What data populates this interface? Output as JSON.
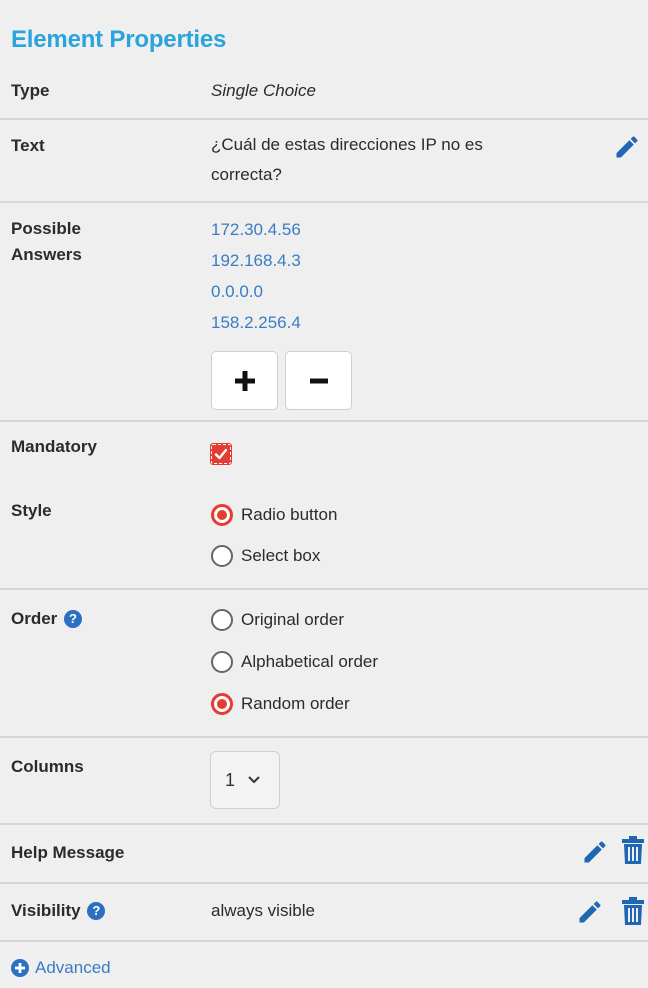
{
  "panel": {
    "title": "Element Properties"
  },
  "type": {
    "label": "Type",
    "value": "Single Choice"
  },
  "text": {
    "label": "Text",
    "line1": "¿Cuál de estas direcciones IP no es",
    "line2": "correcta?"
  },
  "answers": {
    "label_line1": "Possible",
    "label_line2": "Answers",
    "items": [
      "172.30.4.56",
      "192.168.4.3",
      "0.0.0.0",
      "158.2.256.4"
    ],
    "add_label": "+",
    "remove_label": "−"
  },
  "mandatory": {
    "label": "Mandatory",
    "checked": true
  },
  "style": {
    "label": "Style",
    "options": [
      {
        "label": "Radio button",
        "selected": true
      },
      {
        "label": "Select box",
        "selected": false
      }
    ]
  },
  "order": {
    "label": "Order",
    "options": [
      {
        "label": "Original order",
        "selected": false
      },
      {
        "label": "Alphabetical order",
        "selected": false
      },
      {
        "label": "Random order",
        "selected": true
      }
    ]
  },
  "columns": {
    "label": "Columns",
    "value": "1"
  },
  "help_message": {
    "label": "Help Message"
  },
  "visibility": {
    "label": "Visibility",
    "value": "always visible"
  },
  "advanced": {
    "label": "Advanced"
  },
  "colors": {
    "accent": "#2aa4dc",
    "link": "#3a7cc4",
    "selected": "#e53c32",
    "icon": "#1f66b4"
  }
}
